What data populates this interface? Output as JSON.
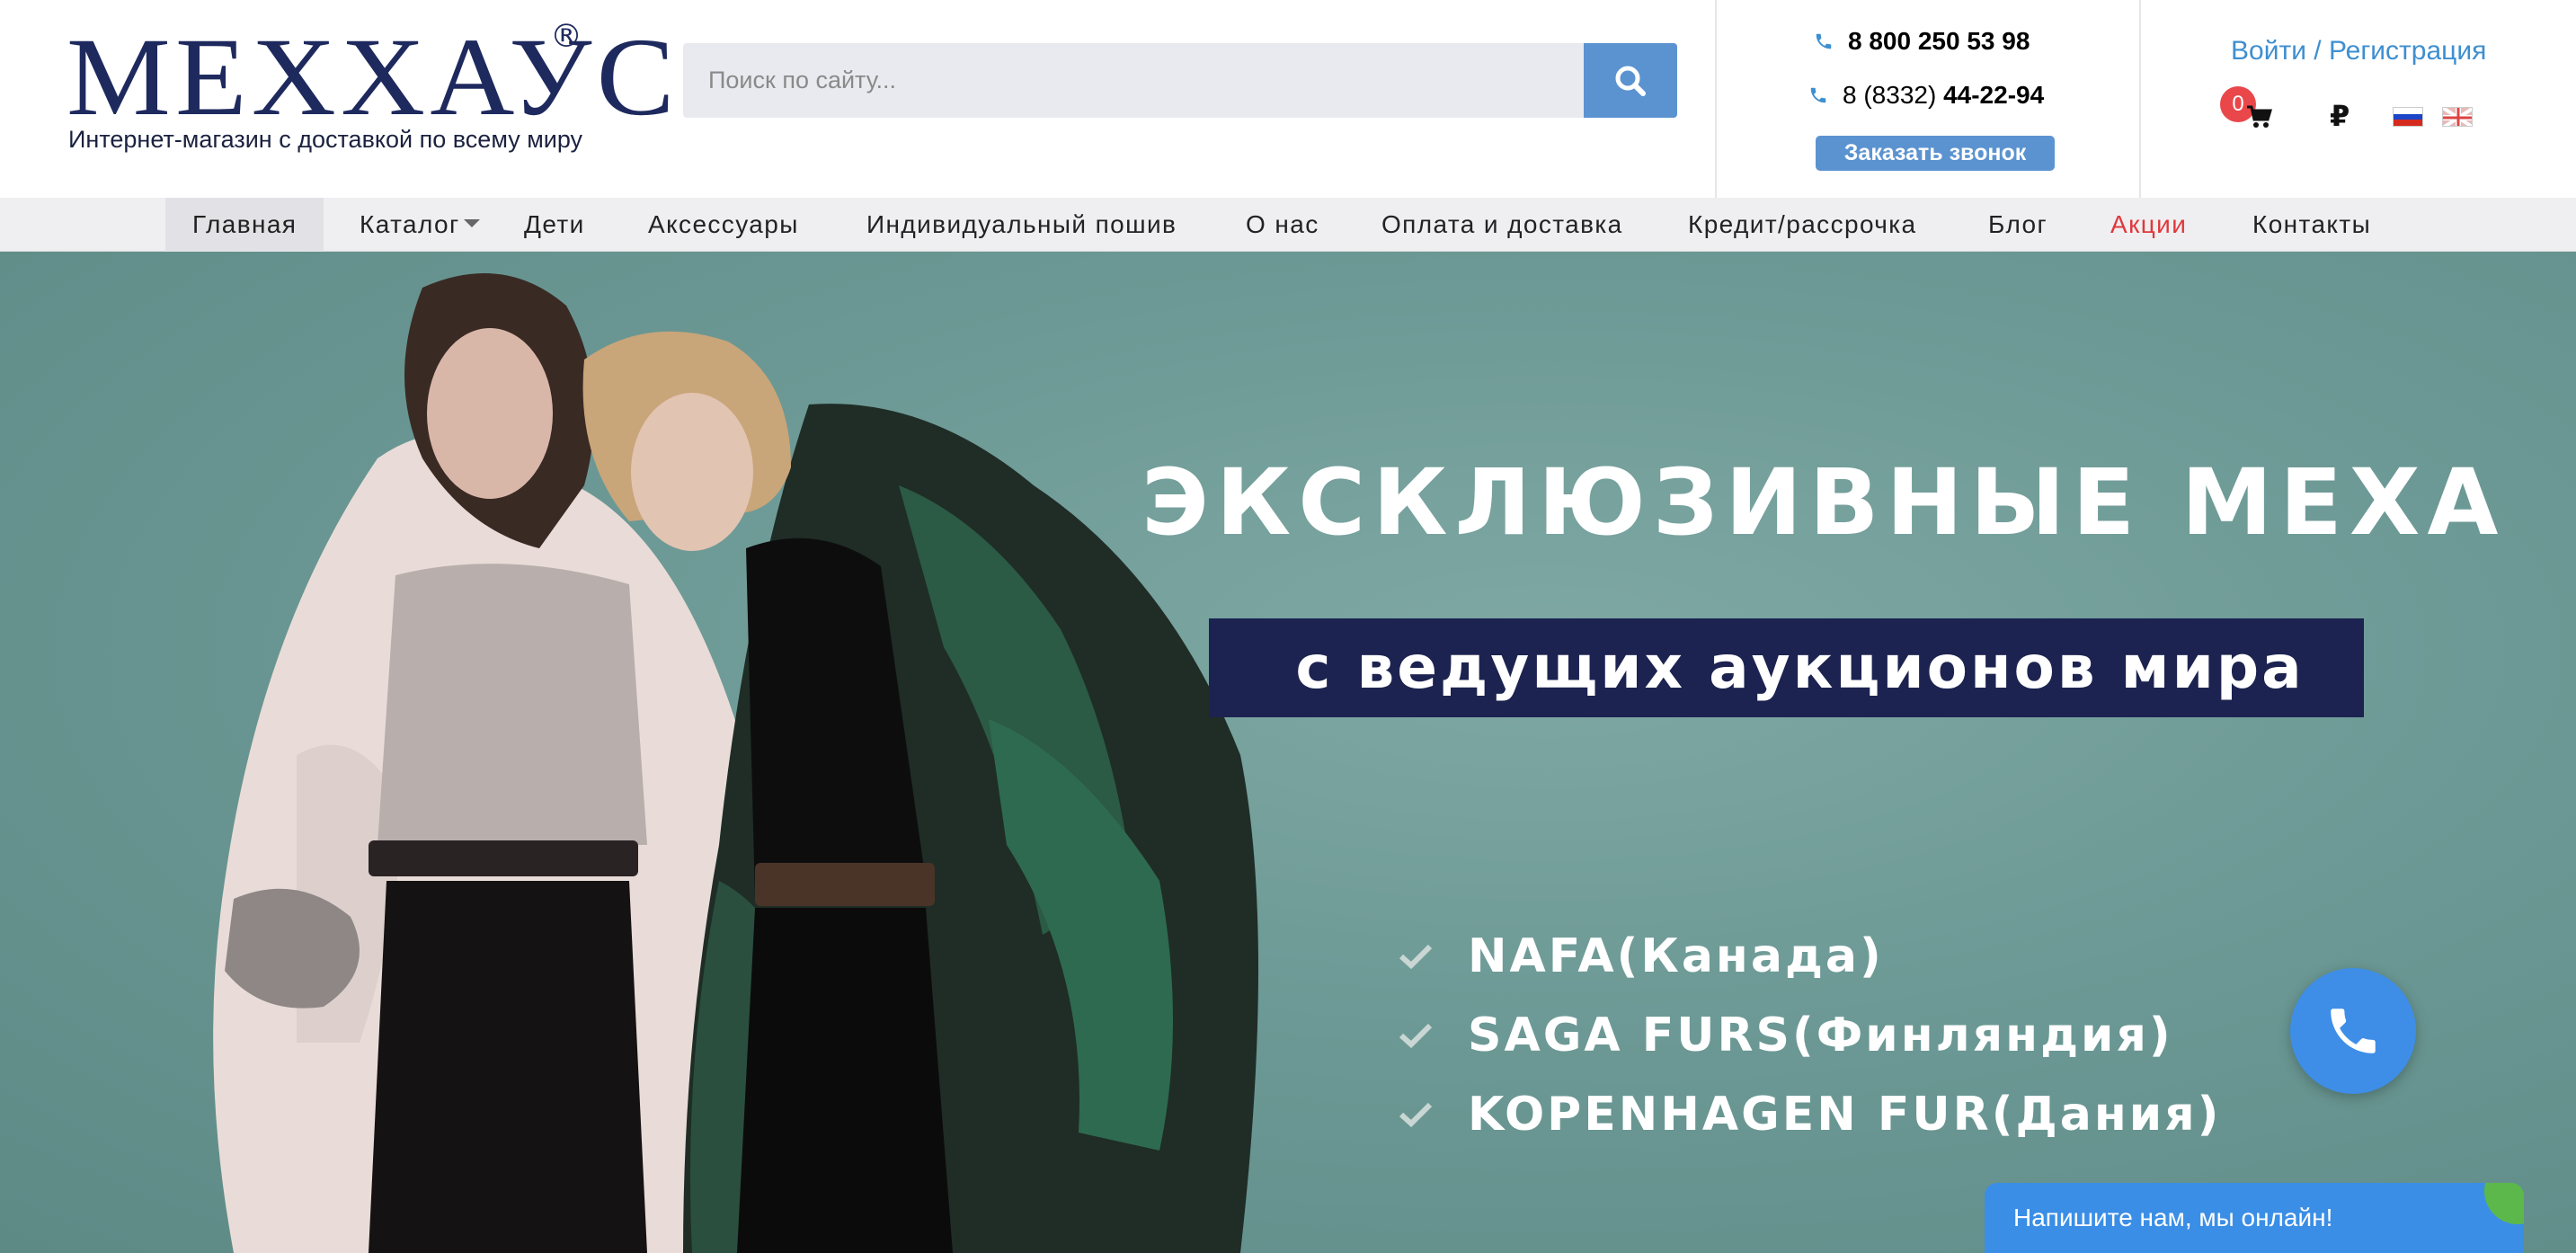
{
  "brand": {
    "logo_text": "МЕХХАУС",
    "registered_mark": "®",
    "tagline": "Интернет-магазин с доставкой по всему миру"
  },
  "search": {
    "placeholder": "Поиск по сайту...",
    "button_icon": "search-icon"
  },
  "contacts": {
    "phone_main": "8 800 250 53 98",
    "phone_local_prefix": "8 (8332)",
    "phone_local_number": "44-22-94",
    "callback_label": "Заказать звонок"
  },
  "account": {
    "login_label": "Войти / Регистрация",
    "cart_count": "0",
    "currency_symbol": "₽",
    "languages": [
      "ru-flag-icon",
      "en-flag-icon"
    ]
  },
  "nav": {
    "items": [
      {
        "label": "Главная",
        "active": true
      },
      {
        "label": "Каталог",
        "has_dropdown": true
      },
      {
        "label": "Дети"
      },
      {
        "label": "Аксессуары"
      },
      {
        "label": "Индивидуальный пошив"
      },
      {
        "label": "О нас"
      },
      {
        "label": "Оплата и доставка"
      },
      {
        "label": "Кредит/рассрочка"
      },
      {
        "label": "Блог"
      },
      {
        "label": "Акции",
        "highlight": true
      },
      {
        "label": "Контакты"
      }
    ]
  },
  "hero": {
    "headline": "ЭКСКЛЮЗИВНЫЕ МЕХА",
    "subheadline": "с ведущих аукционов мира",
    "bullets": [
      "NAFA(Канада)",
      "SAGA FURS(Финляндия)",
      "KOPENHAGEN FUR(Дания)"
    ],
    "background_color": "#6c9995",
    "band_color": "#1c2350"
  },
  "widgets": {
    "call_fab_icon": "phone-icon",
    "chat_label": "Напишите нам, мы онлайн!"
  },
  "colors": {
    "brand_navy": "#1e2a5e",
    "accent_blue": "#5b93d0",
    "link_blue": "#3e8fd0",
    "promo_red": "#e0383b",
    "badge_red": "#e9474a"
  }
}
